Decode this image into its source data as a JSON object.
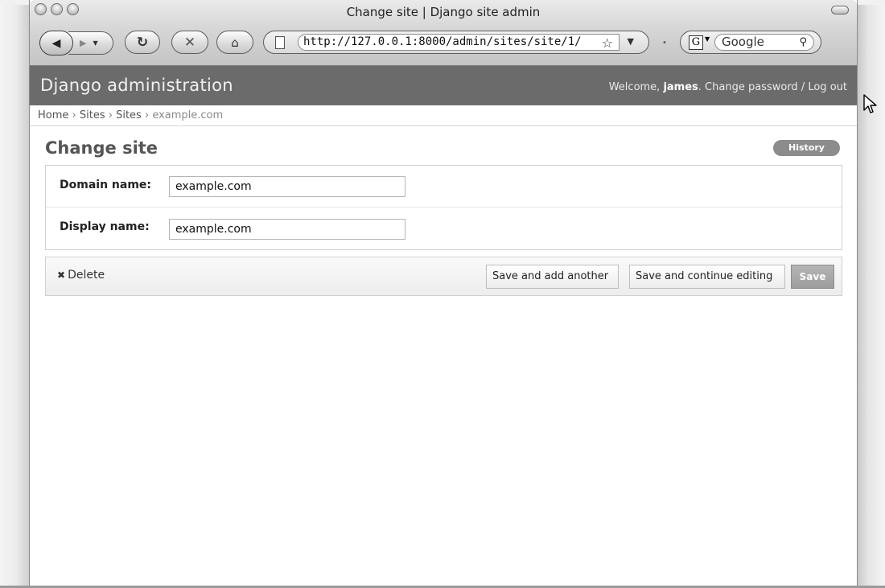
{
  "window": {
    "title": "Change site | Django site admin"
  },
  "toolbar": {
    "url": "http://127.0.0.1:8000/admin/sites/site/1/",
    "search_placeholder": "Google",
    "search_engine_letter": "G"
  },
  "admin": {
    "brand": "Django administration",
    "welcome_prefix": "Welcome, ",
    "username": "james",
    "change_password": ". Change password",
    "separator": " / ",
    "logout": "Log out"
  },
  "breadcrumbs": {
    "home": "Home",
    "sites_app": "Sites",
    "sites_model": "Sites",
    "current": "example.com",
    "sep": "›"
  },
  "page": {
    "title": "Change site",
    "history_label": "History"
  },
  "form": {
    "domain_label": "Domain name:",
    "domain_value": "example.com",
    "display_label": "Display name:",
    "display_value": "example.com"
  },
  "actions": {
    "delete_label": "Delete",
    "save_add_another": "Save and add another",
    "save_continue": "Save and continue editing",
    "save": "Save"
  }
}
